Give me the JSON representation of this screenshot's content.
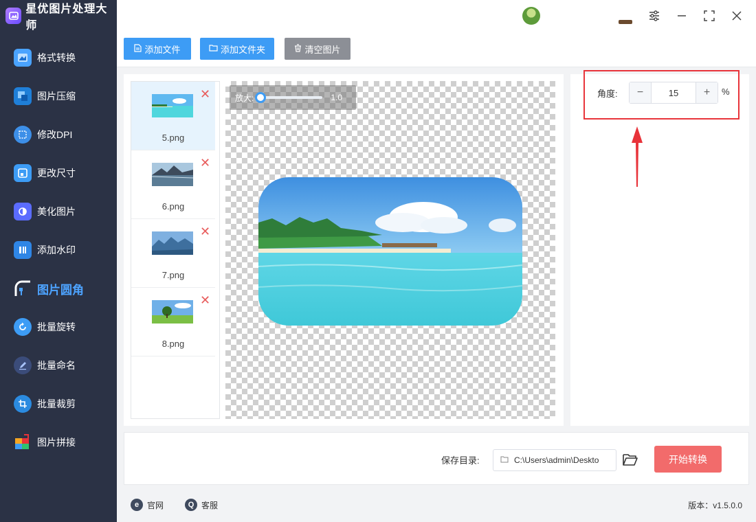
{
  "app": {
    "title": "星优图片处理大师",
    "accent": "#3d9cf5"
  },
  "sidebar": {
    "items": [
      {
        "label": "格式转换",
        "icon": "format-convert-icon"
      },
      {
        "label": "图片压缩",
        "icon": "image-compress-icon"
      },
      {
        "label": "修改DPI",
        "icon": "dpi-icon"
      },
      {
        "label": "更改尺寸",
        "icon": "resize-icon"
      },
      {
        "label": "美化图片",
        "icon": "beautify-icon"
      },
      {
        "label": "添加水印",
        "icon": "watermark-icon"
      },
      {
        "label": "图片圆角",
        "icon": "rounded-corner-icon",
        "active": true
      },
      {
        "label": "批量旋转",
        "icon": "rotate-icon"
      },
      {
        "label": "批量命名",
        "icon": "rename-icon"
      },
      {
        "label": "批量裁剪",
        "icon": "crop-icon"
      },
      {
        "label": "图片拼接",
        "icon": "stitch-icon"
      }
    ]
  },
  "toolbar": {
    "add_file": "添加文件",
    "add_folder": "添加文件夹",
    "clear": "清空图片"
  },
  "files": [
    {
      "name": "5.png",
      "selected": true
    },
    {
      "name": "6.png"
    },
    {
      "name": "7.png"
    },
    {
      "name": "8.png"
    }
  ],
  "preview": {
    "zoom_label": "放大:",
    "zoom_value": "1.0",
    "zoom_fraction": 0.0
  },
  "settings": {
    "angle_label": "角度:",
    "angle_value": "15",
    "angle_unit": "%",
    "minus": "−",
    "plus": "+"
  },
  "bottom": {
    "save_label": "保存目录:",
    "save_path": "C:\\Users\\admin\\Deskto",
    "start_label": "开始转换"
  },
  "footer": {
    "website": "官网",
    "service": "客服",
    "version": "版本：v1.5.0.0"
  }
}
